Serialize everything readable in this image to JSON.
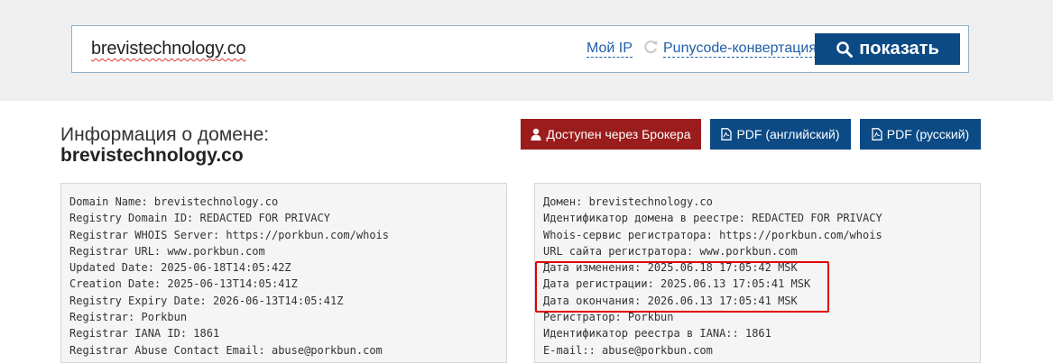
{
  "search": {
    "value": "brevistechnology.co",
    "my_ip_label": "Мой IP",
    "punycode_label": "Punycode-конвертация",
    "show_button_label": "показать"
  },
  "info": {
    "title": "Информация о домене:",
    "domain": "brevistechnology.co"
  },
  "buttons": {
    "broker": "Доступен через Брокера",
    "pdf_en": "PDF (английский)",
    "pdf_ru": "PDF (русский)"
  },
  "whois_en": [
    "Domain Name: brevistechnology.co",
    "Registry Domain ID: REDACTED FOR PRIVACY",
    "Registrar WHOIS Server: https://porkbun.com/whois",
    "Registrar URL: www.porkbun.com",
    "Updated Date: 2025-06-18T14:05:42Z",
    "Creation Date: 2025-06-13T14:05:41Z",
    "Registry Expiry Date: 2026-06-13T14:05:41Z",
    "Registrar: Porkbun",
    "Registrar IANA ID: 1861",
    "Registrar Abuse Contact Email: abuse@porkbun.com"
  ],
  "whois_ru": [
    "Домен: brevistechnology.co",
    "Идентификатор домена в реестре: REDACTED FOR PRIVACY",
    "Whois-сервис регистратора: https://porkbun.com/whois",
    "URL сайта регистратора: www.porkbun.com",
    "Дата изменения: 2025.06.18 17:05:42 MSK",
    "Дата регистрации: 2025.06.13 17:05:41 MSK",
    "Дата окончания: 2026.06.13 17:05:41 MSK",
    "Регистратор: Porkbun",
    "Идентификатор реестра в IANA:: 1861",
    "E-mail:: abuse@porkbun.com"
  ],
  "colors": {
    "primary": "#0b4a85",
    "broker": "#9b1c1c",
    "highlight": "#e00000",
    "link": "#1f5fa5"
  }
}
